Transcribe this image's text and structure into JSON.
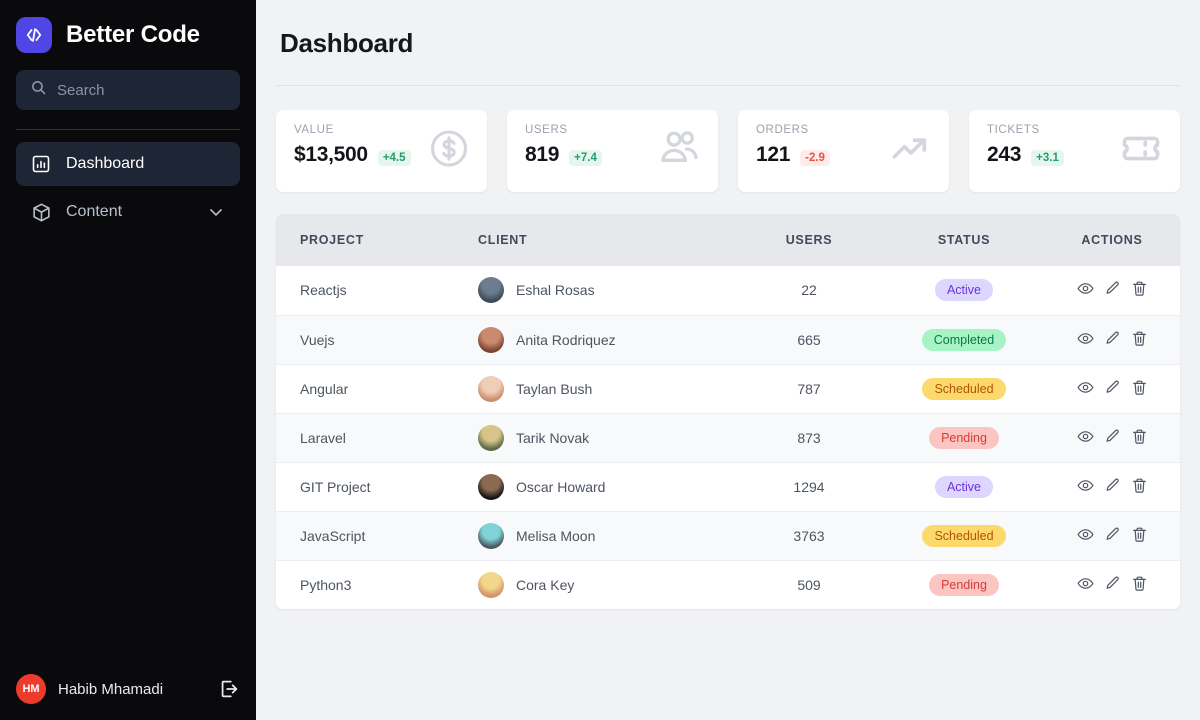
{
  "sidebar": {
    "brand": {
      "name": "Better Code",
      "logo_icon": "code-brackets-icon",
      "logo_color": "#4f46e5"
    },
    "search": {
      "placeholder": "Search",
      "value": "",
      "icon": "search-icon"
    },
    "nav_items": [
      {
        "label": "Dashboard",
        "icon": "chart-bar-icon",
        "active": true,
        "has_chevron": false
      },
      {
        "label": "Content",
        "icon": "cube-icon",
        "active": false,
        "has_chevron": true
      }
    ],
    "footer": {
      "user_initials": "HM",
      "user_name": "Habib Mhamadi",
      "avatar_color": "#ef3b2d",
      "logout_icon": "logout-icon"
    }
  },
  "header": {
    "title": "Dashboard"
  },
  "cards": [
    {
      "label": "VALUE",
      "value": "$13,500",
      "delta": "+4.5",
      "delta_dir": "up",
      "icon": "dollar-circle-icon"
    },
    {
      "label": "USERS",
      "value": "819",
      "delta": "+7.4",
      "delta_dir": "up",
      "icon": "users-icon"
    },
    {
      "label": "ORDERS",
      "value": "121",
      "delta": "-2.9",
      "delta_dir": "down",
      "icon": "trending-up-icon"
    },
    {
      "label": "TICKETS",
      "value": "243",
      "delta": "+3.1",
      "delta_dir": "up",
      "icon": "ticket-icon"
    }
  ],
  "table": {
    "columns": [
      "PROJECT",
      "CLIENT",
      "USERS",
      "STATUS",
      "ACTIONS"
    ],
    "action_icons": [
      "eye-icon",
      "pencil-icon",
      "trash-icon"
    ],
    "rows": [
      {
        "project": "Reactjs",
        "client": "Eshal Rosas",
        "users": "22",
        "status": "Active",
        "status_key": "active",
        "avatar_a": "#6b7d8f",
        "avatar_b": "#3d4a57"
      },
      {
        "project": "Vuejs",
        "client": "Anita Rodriquez",
        "users": "665",
        "status": "Completed",
        "status_key": "completed",
        "avatar_a": "#c98a6e",
        "avatar_b": "#7a4632"
      },
      {
        "project": "Angular",
        "client": "Taylan Bush",
        "users": "787",
        "status": "Scheduled",
        "status_key": "scheduled",
        "avatar_a": "#f0cdb6",
        "avatar_b": "#c98f6a"
      },
      {
        "project": "Laravel",
        "client": "Tarik Novak",
        "users": "873",
        "status": "Pending",
        "status_key": "pending",
        "avatar_a": "#d8c38a",
        "avatar_b": "#5c6b4a"
      },
      {
        "project": "GIT Project",
        "client": "Oscar Howard",
        "users": "1294",
        "status": "Active",
        "status_key": "active",
        "avatar_a": "#8a6a52",
        "avatar_b": "#1a1512"
      },
      {
        "project": "JavaScript",
        "client": "Melisa Moon",
        "users": "3763",
        "status": "Scheduled",
        "status_key": "scheduled",
        "avatar_a": "#7fd3d8",
        "avatar_b": "#4a5a63"
      },
      {
        "project": "Python3",
        "client": "Cora Key",
        "users": "509",
        "status": "Pending",
        "status_key": "pending",
        "avatar_a": "#f2d68c",
        "avatar_b": "#d4936a"
      }
    ]
  },
  "colors": {
    "sidebar_bg": "#0a0a0c",
    "sidebar_panel": "#1e2534",
    "accent": "#4f46e5",
    "main_bg": "#f1f2f4",
    "card_bg": "#ffffff",
    "table_head_bg": "#e6e8ec"
  }
}
